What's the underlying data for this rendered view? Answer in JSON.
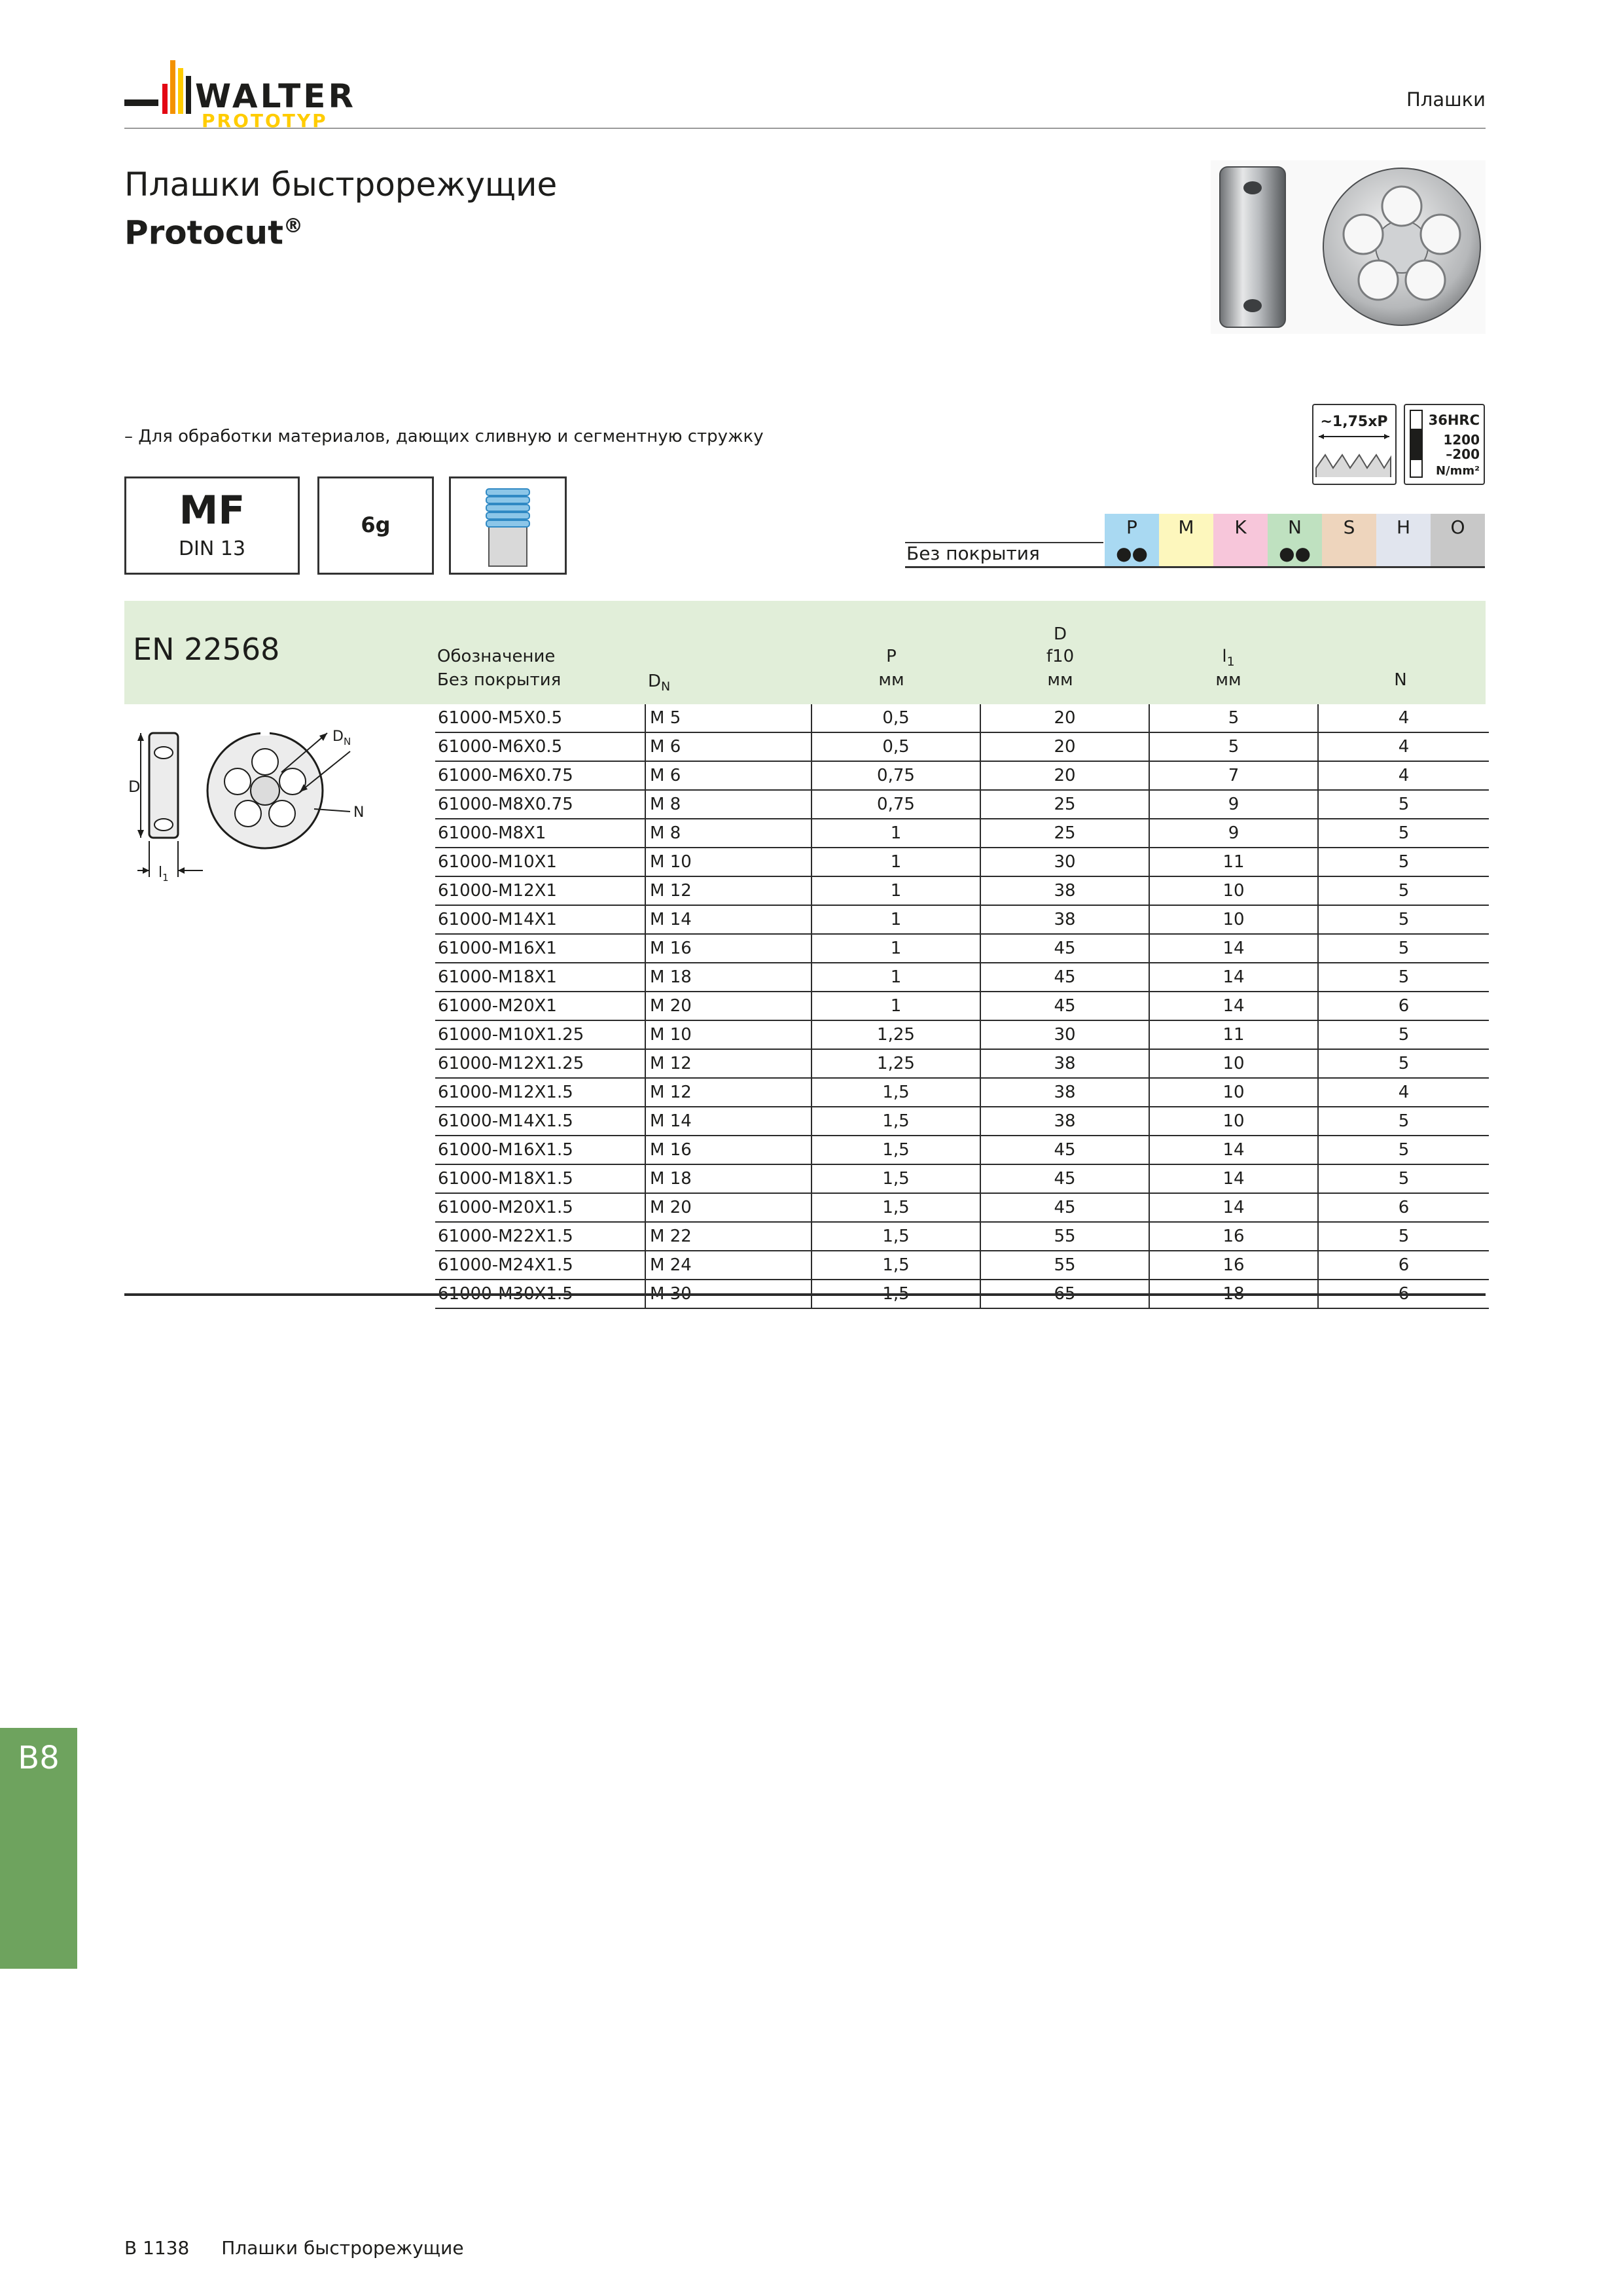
{
  "brand": {
    "name": "WALTER",
    "sub": "PROTOTYP"
  },
  "header": {
    "section": "Плашки"
  },
  "title": {
    "line1": "Плашки быстрорежущие",
    "line2": "Protocut",
    "mark": "®"
  },
  "feature": "– Для обработки материалов, дающих сливную и сегментную стружку",
  "icons": {
    "pitch_label": "~1,75xP",
    "hardness_top": "36HRC",
    "hardness_mid1": "1200",
    "hardness_mid2": "–200",
    "hardness_unit": "N/mm²"
  },
  "attributes": {
    "thread_type": "MF",
    "standard": "DIN 13",
    "tolerance": "6g"
  },
  "materials": {
    "groups": [
      {
        "code": "P",
        "color": "#a9d9f2"
      },
      {
        "code": "M",
        "color": "#fdf7bd"
      },
      {
        "code": "K",
        "color": "#f7c6da"
      },
      {
        "code": "N",
        "color": "#bfe1c0"
      },
      {
        "code": "S",
        "color": "#eed5bd"
      },
      {
        "code": "H",
        "color": "#e1e5ee"
      },
      {
        "code": "O",
        "color": "#c8c8c8"
      }
    ],
    "coating_label": "Без покрытия",
    "marks": [
      "●●",
      "",
      "",
      "●●",
      "",
      "",
      ""
    ]
  },
  "standard_label": "EN 22568",
  "columns": {
    "designation_1": "Обозначение",
    "designation_2": "Без покрытия",
    "dn": "D",
    "dn_sub": "N",
    "p": "P",
    "p_unit": "мм",
    "d_top": "D",
    "d_tol": "f10",
    "d_unit": "мм",
    "l1": "l",
    "l1_sub": "1",
    "l1_unit": "мм",
    "n": "N"
  },
  "diagram": {
    "label_d": "D",
    "label_dn": "D",
    "label_dn_sub": "N",
    "label_n": "N",
    "label_l1": "l",
    "label_l1_sub": "1"
  },
  "rows": [
    [
      "61000-M5X0.5",
      "M 5",
      "0,5",
      "20",
      "5",
      "4"
    ],
    [
      "61000-M6X0.5",
      "M 6",
      "0,5",
      "20",
      "5",
      "4"
    ],
    [
      "61000-M6X0.75",
      "M 6",
      "0,75",
      "20",
      "7",
      "4"
    ],
    [
      "61000-M8X0.75",
      "M 8",
      "0,75",
      "25",
      "9",
      "5"
    ],
    [
      "61000-M8X1",
      "M 8",
      "1",
      "25",
      "9",
      "5"
    ],
    [
      "61000-M10X1",
      "M 10",
      "1",
      "30",
      "11",
      "5"
    ],
    [
      "61000-M12X1",
      "M 12",
      "1",
      "38",
      "10",
      "5"
    ],
    [
      "61000-M14X1",
      "M 14",
      "1",
      "38",
      "10",
      "5"
    ],
    [
      "61000-M16X1",
      "M 16",
      "1",
      "45",
      "14",
      "5"
    ],
    [
      "61000-M18X1",
      "M 18",
      "1",
      "45",
      "14",
      "5"
    ],
    [
      "61000-M20X1",
      "M 20",
      "1",
      "45",
      "14",
      "6"
    ],
    [
      "61000-M10X1.25",
      "M 10",
      "1,25",
      "30",
      "11",
      "5"
    ],
    [
      "61000-M12X1.25",
      "M 12",
      "1,25",
      "38",
      "10",
      "5"
    ],
    [
      "61000-M12X1.5",
      "M 12",
      "1,5",
      "38",
      "10",
      "4"
    ],
    [
      "61000-M14X1.5",
      "M 14",
      "1,5",
      "38",
      "10",
      "5"
    ],
    [
      "61000-M16X1.5",
      "M 16",
      "1,5",
      "45",
      "14",
      "5"
    ],
    [
      "61000-M18X1.5",
      "M 18",
      "1,5",
      "45",
      "14",
      "5"
    ],
    [
      "61000-M20X1.5",
      "M 20",
      "1,5",
      "45",
      "14",
      "6"
    ],
    [
      "61000-M22X1.5",
      "M 22",
      "1,5",
      "55",
      "16",
      "5"
    ],
    [
      "61000-M24X1.5",
      "M 24",
      "1,5",
      "55",
      "16",
      "6"
    ],
    [
      "61000-M30X1.5",
      "M 30",
      "1,5",
      "65",
      "18",
      "6"
    ]
  ],
  "side_tab": "B8",
  "footer": {
    "page": "B 1138",
    "title": "Плашки быстрорежущие"
  }
}
